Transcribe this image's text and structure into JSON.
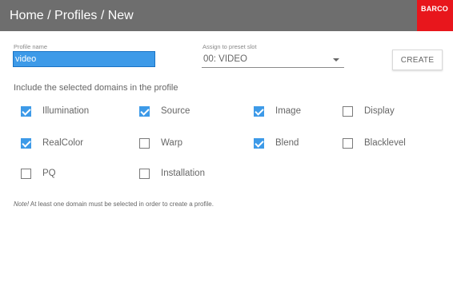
{
  "header": {
    "breadcrumb": "Home / Profiles / New",
    "logo_text": "BARCO",
    "color": "#6e6e6e",
    "logo_color": "#e8161c"
  },
  "form": {
    "profile_name_label": "Profile name",
    "profile_name_value": "video",
    "preset_slot_label": "Assign to preset slot",
    "preset_slot_value": "00: VIDEO",
    "create_label": "CREATE"
  },
  "domains": {
    "title": "Include the selected domains in the profile",
    "items": [
      {
        "label": "Illumination",
        "checked": true
      },
      {
        "label": "Source",
        "checked": true
      },
      {
        "label": "Image",
        "checked": true
      },
      {
        "label": "Display",
        "checked": false
      },
      {
        "label": "RealColor",
        "checked": true
      },
      {
        "label": "Warp",
        "checked": false
      },
      {
        "label": "Blend",
        "checked": true
      },
      {
        "label": "Blacklevel",
        "checked": false
      },
      {
        "label": "PQ",
        "checked": false
      },
      {
        "label": "Installation",
        "checked": false
      }
    ]
  },
  "note": {
    "prefix": "Note!",
    "text": " At least one domain must be selected in order to create a profile."
  },
  "accent_color": "#3d9ae8"
}
